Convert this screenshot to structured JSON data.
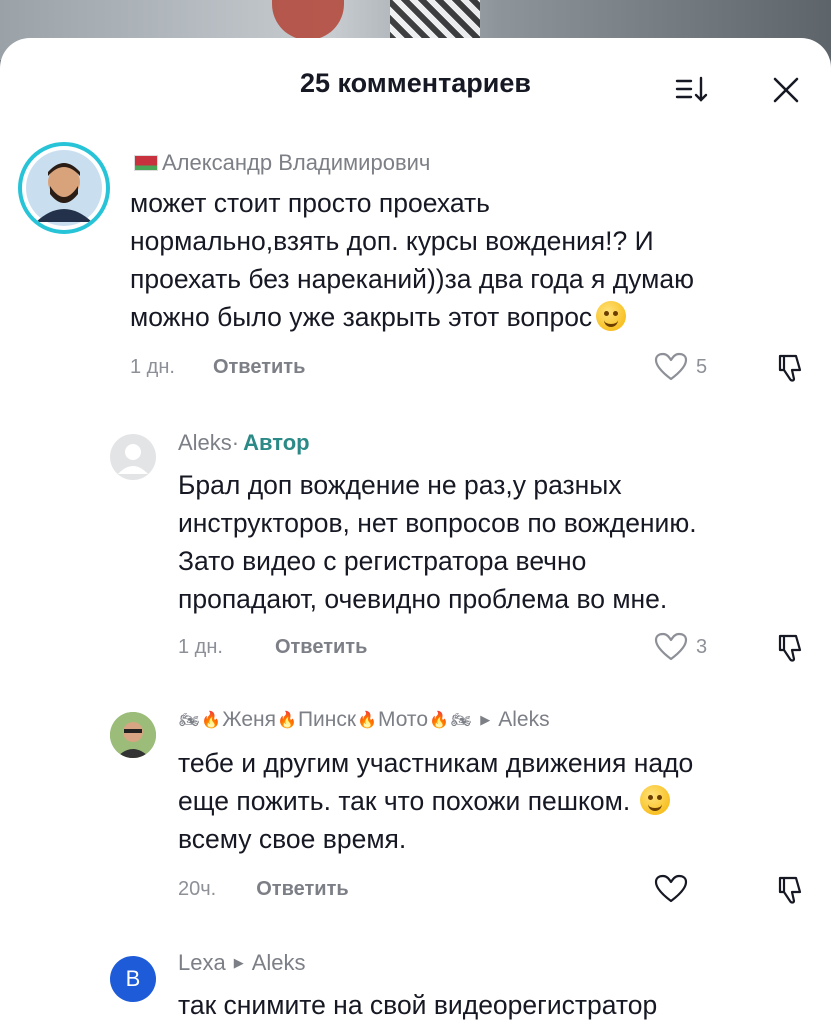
{
  "sheet": {
    "title": "25 комментариев"
  },
  "comments": [
    {
      "author": "Александр Владимирович",
      "text_lines": [
        "может стоит просто проехать",
        "нормально,взять доп. курсы вождения!? И",
        "проехать без нареканий))за два года я думаю",
        "можно было уже закрыть этот вопрос"
      ],
      "time": "1 дн.",
      "reply_label": "Ответить",
      "likes": "5"
    },
    {
      "author": "Aleks",
      "badge_sep": " · ",
      "badge": "Автор",
      "text_lines": [
        "Брал доп вождение не раз,у разных",
        "инструкторов, нет вопросов по вождению.",
        "Зато видео с регистратора вечно",
        "пропадают, очевидно проблема во мне."
      ],
      "time": "1 дн.",
      "reply_label": "Ответить",
      "likes": "3"
    },
    {
      "author_parts": [
        "Женя",
        "Пинск",
        "Мото"
      ],
      "reply_to": "Aleks",
      "text_lines": [
        "тебе и другим участникам движения надо",
        "еще пожить. так что похожи пешком.",
        "всему свое время."
      ],
      "time": "20ч.",
      "reply_label": "Ответить",
      "likes": ""
    },
    {
      "avatar_letter": "B",
      "author": "Lexa",
      "reply_to": "Aleks",
      "text_lines": [
        "так снимите на свой видеорегистратор"
      ]
    }
  ],
  "colors": {
    "text": "#161823",
    "muted": "#8d9097",
    "author_badge": "#2b8a87",
    "avatar_b": "#1e5bd8",
    "story_ring": "#27c4d8"
  },
  "icons": [
    "sort-icon",
    "close-icon",
    "heart-icon",
    "dislike-icon",
    "flag-icon",
    "sweat-smile-emoji",
    "wink-emoji",
    "motorcycle-icon",
    "fire-icon"
  ]
}
